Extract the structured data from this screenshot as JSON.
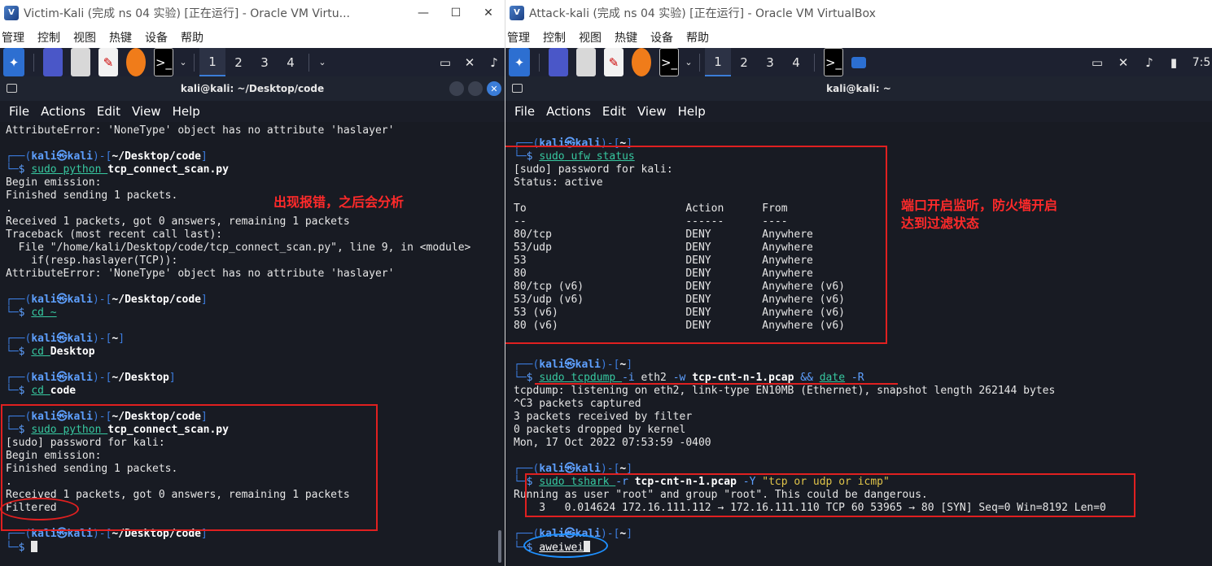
{
  "left_window": {
    "title": "Victim-Kali (完成 ns 04 实验) [正在运行] - Oracle VM Virtu...",
    "controls": [
      "—",
      "☐",
      "✕"
    ],
    "menu": [
      "管理",
      "控制",
      "视图",
      "热键",
      "设备",
      "帮助"
    ],
    "workspaces": [
      "1",
      "2",
      "3",
      "4"
    ],
    "terminal_title": "kali@kali: ~/Desktop/code",
    "terminal_menu": [
      "File",
      "Actions",
      "Edit",
      "View",
      "Help"
    ],
    "lines": [
      "AttributeError: 'NoneType' object has no attribute 'haslayer'",
      "",
      "$P|kali|kali|~/Desktop/code",
      "$C|sudo| python |tcp_connect_scan.py",
      "Begin emission:",
      "Finished sending 1 packets.",
      ".",
      "Received 1 packets, got 0 answers, remaining 1 packets",
      "Traceback (most recent call last):",
      "  File \"/home/kali/Desktop/code/tcp_connect_scan.py\", line 9, in <module>",
      "    if(resp.haslayer(TCP)):",
      "AttributeError: 'NoneType' object has no attribute 'haslayer'",
      "",
      "$P|kali|kali|~/Desktop/code",
      "$S|cd ~",
      "",
      "$P|kali|kali|~",
      "$S|cd |Desktop",
      "",
      "$P|kali|kali|~/Desktop",
      "$S|cd |code",
      "",
      "$P|kali|kali|~/Desktop/code",
      "$C|sudo| python |tcp_connect_scan.py",
      "[sudo] password for kali:",
      "Begin emission:",
      "Finished sending 1 packets.",
      ".",
      "Received 1 packets, got 0 answers, remaining 1 packets",
      "Filtered",
      "",
      "$P|kali|kali|~/Desktop/code",
      "$CUR"
    ],
    "annotation": "出现报错，之后会分析"
  },
  "right_window": {
    "title": "Attack-kali (完成 ns 04 实验) [正在运行] - Oracle VM VirtualBox",
    "menu": [
      "管理",
      "控制",
      "视图",
      "热键",
      "设备",
      "帮助"
    ],
    "workspaces": [
      "1",
      "2",
      "3",
      "4"
    ],
    "clock": "7:5",
    "terminal_title": "kali@kali: ~",
    "terminal_menu": [
      "File",
      "Actions",
      "Edit",
      "View",
      "Help"
    ],
    "lines": [
      "",
      "$P|kali|kali|~",
      "$U|sudo| ufw status",
      "[sudo] password for kali:",
      "Status: active",
      "",
      "To                         Action      From",
      "--                         ------      ----",
      "80/tcp                     DENY        Anywhere",
      "53/udp                     DENY        Anywhere",
      "53                         DENY        Anywhere",
      "80                         DENY        Anywhere",
      "80/tcp (v6)                DENY        Anywhere (v6)",
      "53/udp (v6)                DENY        Anywhere (v6)",
      "53 (v6)                    DENY        Anywhere (v6)",
      "80 (v6)                    DENY        Anywhere (v6)",
      "",
      "",
      "$P|kali|kali|~",
      "$D|sudo| tcpdump |-i| eth2 |-w| |tcp-cnt-n-1.pcap| |&&| |date| |-R",
      "tcpdump: listening on eth2, link-type EN10MB (Ethernet), snapshot length 262144 bytes",
      "^C3 packets captured",
      "3 packets received by filter",
      "0 packets dropped by kernel",
      "Mon, 17 Oct 2022 07:53:59 -0400",
      "",
      "$P|kali|kali|~",
      "$T|sudo| tshark |-r| |tcp-cnt-n-1.pcap| |-Y| |\"tcp or udp or icmp\"",
      "Running as user \"root\" and group \"root\". This could be dangerous.",
      "    3   0.014624 172.16.111.112 → 172.16.111.110 TCP 60 53965 → 80 [SYN] Seq=0 Win=8192 Len=0",
      "",
      "$P|kali|kali|~",
      "$W|aweiwei"
    ],
    "annotation": "端口开启监听，防火墙开启\n达到过滤状态"
  }
}
